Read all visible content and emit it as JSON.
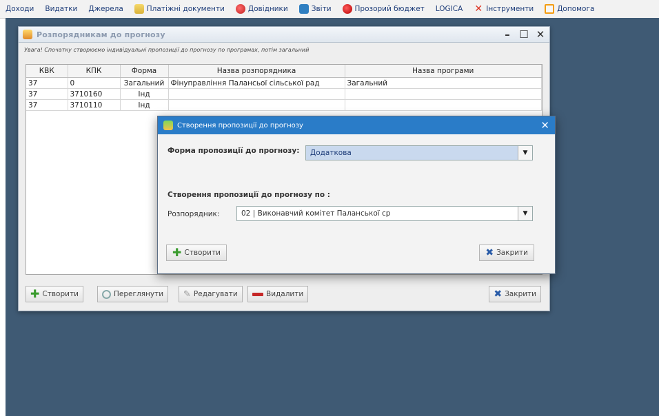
{
  "menu": [
    {
      "label": "Доходи",
      "icon": ""
    },
    {
      "label": "Видатки",
      "icon": ""
    },
    {
      "label": "Джерела",
      "icon": ""
    },
    {
      "label": "Платіжні документи",
      "icon": "folder-icon"
    },
    {
      "label": "Довідники",
      "icon": "globe-icon"
    },
    {
      "label": "Звіти",
      "icon": "mail-icon"
    },
    {
      "label": "Прозорий бюджет",
      "icon": "red-circle-icon"
    },
    {
      "label": "LOGICA",
      "icon": ""
    },
    {
      "label": "Інструменти",
      "icon": "tools-icon"
    },
    {
      "label": "Допомога",
      "icon": "help-icon"
    }
  ],
  "window": {
    "title": "Розпорядникам до прогнозу",
    "hint": "Увага! Спочатку створюємо індивідуальні пропозиції до прогнозу по програмах, потім загальний",
    "columns": [
      "КВК",
      "КПК",
      "Форма",
      "Назва розпорядника",
      "Назва програми"
    ],
    "rows": [
      [
        "37",
        "0",
        "Загальний",
        "Фінуправління Палансьої сільської рад",
        "Загальний"
      ],
      [
        "37",
        "3710160",
        "Інд",
        "",
        ""
      ],
      [
        "37",
        "3710110",
        "Інд",
        "",
        ""
      ]
    ],
    "buttons": {
      "create": "Створити",
      "view": "Переглянути",
      "edit": "Редагувати",
      "delete": "Видалити",
      "close": "Закрити"
    }
  },
  "dialog": {
    "title": "Створення пропозиції до прогнозу",
    "form_label": "Форма пропозиції до прогнозу:",
    "form_value": "Додаткова",
    "section_label": "Створення пропозиції до прогнозу по :",
    "raz_label": "Розпорядник:",
    "raz_value": "02 | Виконавчий комітет Паланської ср",
    "create": "Створити",
    "close": "Закрити"
  }
}
